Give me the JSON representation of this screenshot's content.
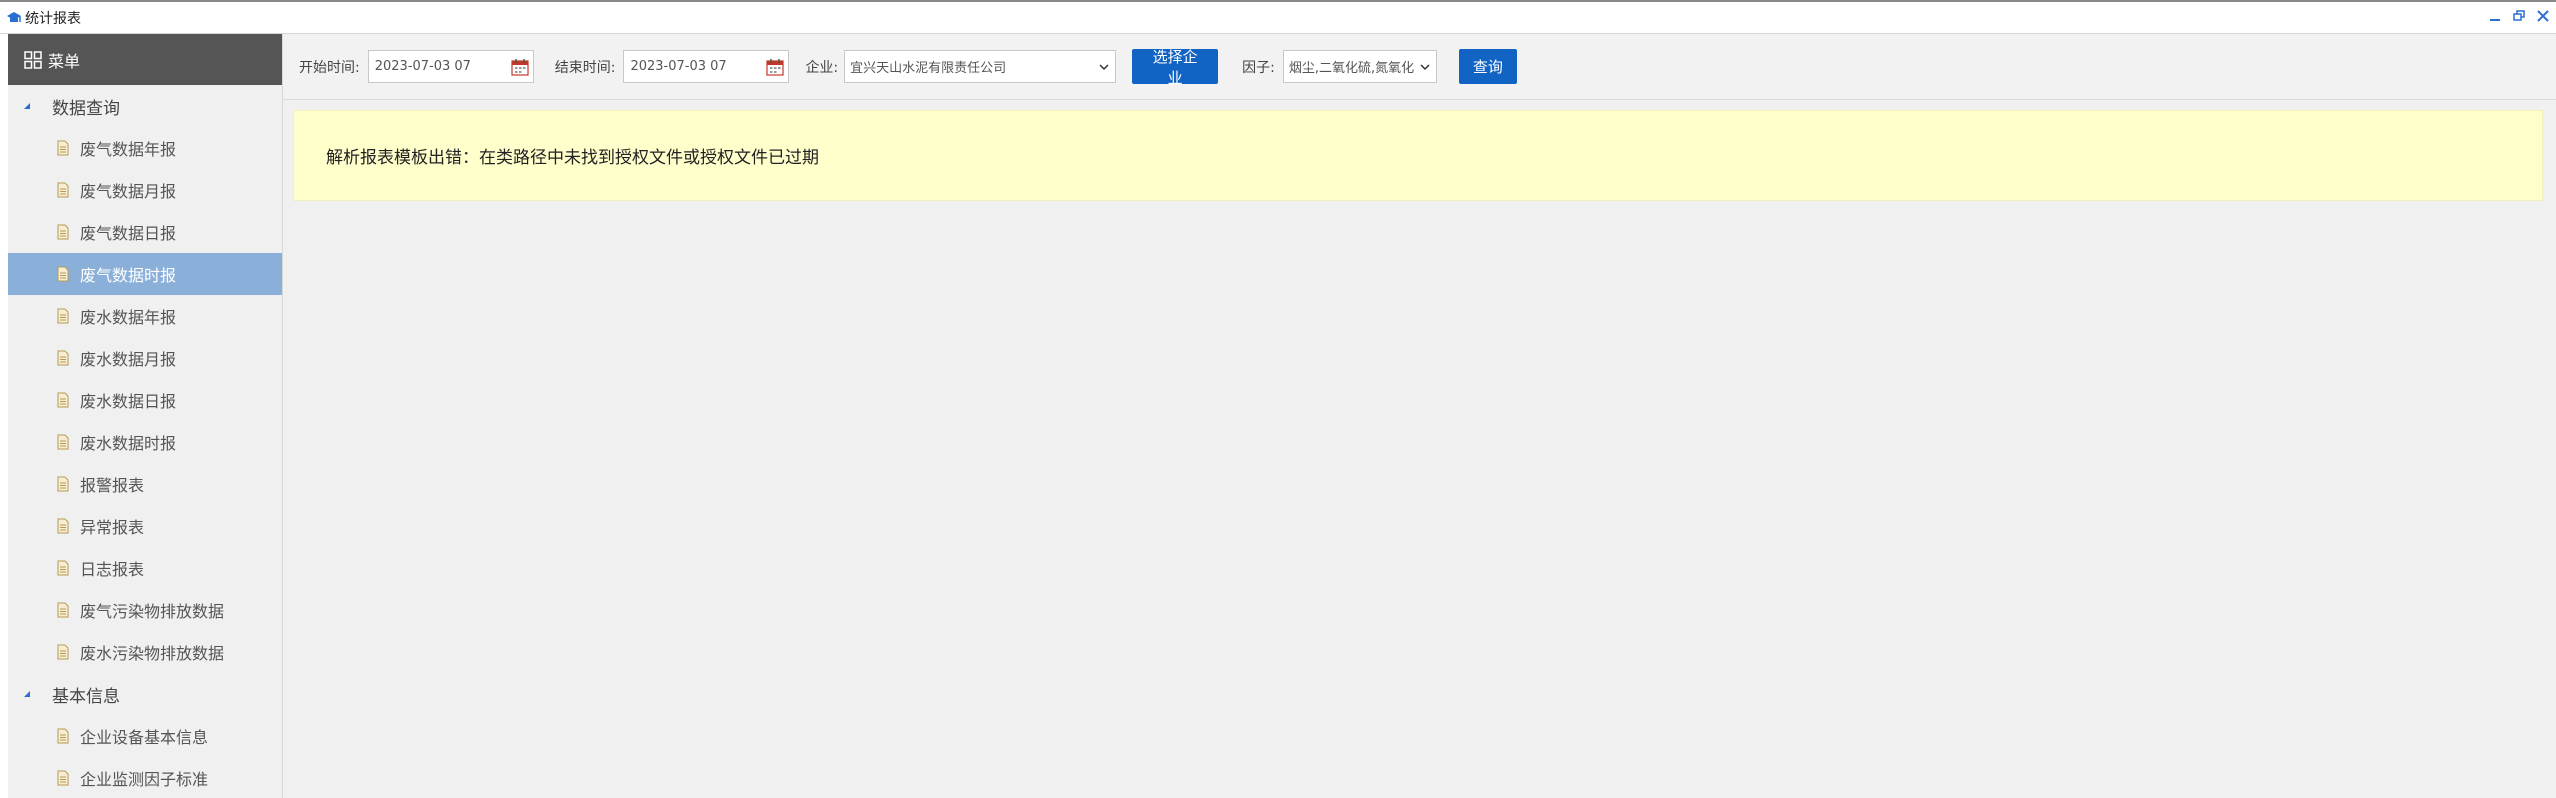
{
  "window": {
    "title": "统计报表",
    "icons": [
      "graduation-cap-icon",
      "minimize-icon",
      "restore-icon",
      "close-icon"
    ]
  },
  "menu": {
    "header": "菜单",
    "groups": [
      {
        "title": "数据查询",
        "items": [
          {
            "label": "废气数据年报",
            "active": false
          },
          {
            "label": "废气数据月报",
            "active": false
          },
          {
            "label": "废气数据日报",
            "active": false
          },
          {
            "label": "废气数据时报",
            "active": true
          },
          {
            "label": "废水数据年报",
            "active": false
          },
          {
            "label": "废水数据月报",
            "active": false
          },
          {
            "label": "废水数据日报",
            "active": false
          },
          {
            "label": "废水数据时报",
            "active": false
          },
          {
            "label": "报警报表",
            "active": false
          },
          {
            "label": "异常报表",
            "active": false
          },
          {
            "label": "日志报表",
            "active": false
          },
          {
            "label": "废气污染物排放数据",
            "active": false
          },
          {
            "label": "废水污染物排放数据",
            "active": false
          }
        ]
      },
      {
        "title": "基本信息",
        "items": [
          {
            "label": "企业设备基本信息",
            "active": false
          },
          {
            "label": "企业监测因子标准",
            "active": false
          }
        ]
      }
    ]
  },
  "toolbar": {
    "start_label": "开始时间:",
    "start_value": "2023-07-03 07",
    "end_label": "结束时间:",
    "end_value": "2023-07-03 07",
    "company_label": "企业:",
    "company_value": "宜兴天山水泥有限责任公司",
    "select_company_button": "选择企业",
    "factor_label": "因子:",
    "factor_value": "烟尘,二氧化硫,氮氧化",
    "query_button": "查询"
  },
  "content": {
    "error_message": "解析报表模板出错：在类路径中未找到授权文件或授权文件已过期"
  },
  "colors": {
    "menu_header": "#555555",
    "active_item": "#8ab0d9",
    "button_blue": "#1264c4",
    "error_bg": "#ffffcc",
    "icon_blue": "#2a6fd0"
  }
}
